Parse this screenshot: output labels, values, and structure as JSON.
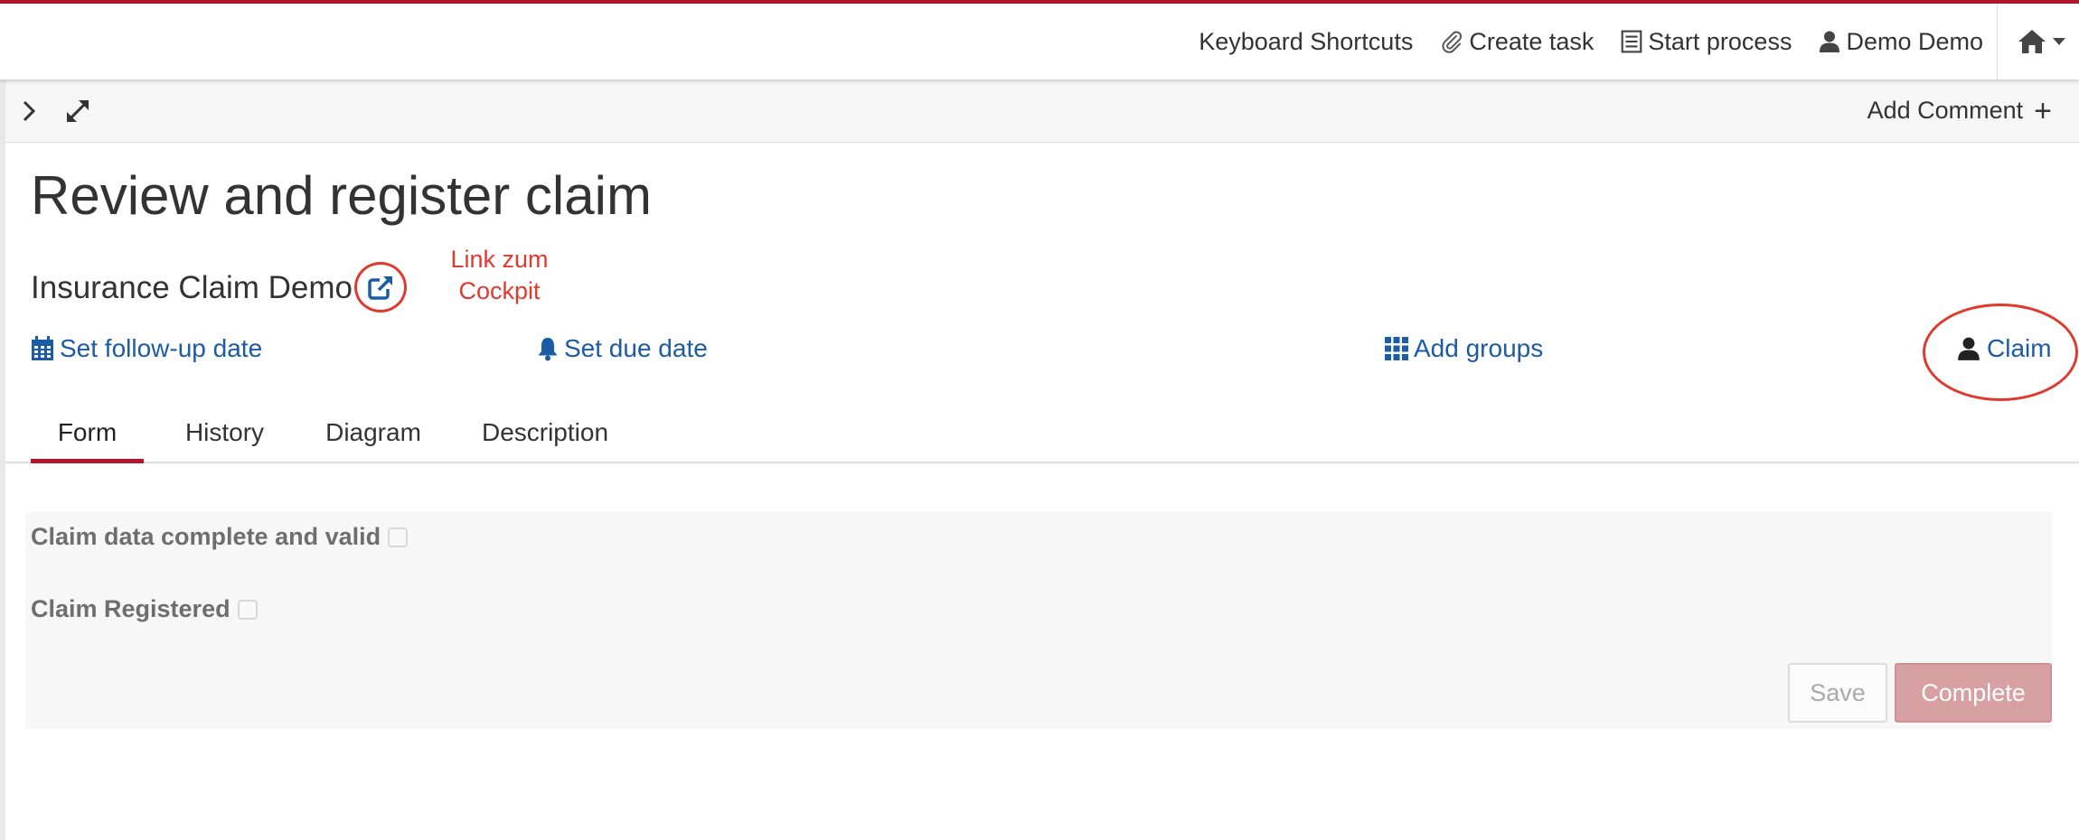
{
  "colors": {
    "brand": "#b5152b",
    "link": "#1c5ba5",
    "annotation": "#e03a2f",
    "complete_button": "#d7a0a3"
  },
  "navbar": {
    "keyboard_shortcuts": "Keyboard Shortcuts",
    "create_task": "Create task",
    "start_process": "Start process",
    "user": "Demo Demo",
    "icons": [
      "paperclip-icon",
      "list-icon",
      "user-icon",
      "home-icon",
      "caret-down-icon"
    ]
  },
  "toolbar": {
    "add_comment": "Add Comment",
    "add_comment_plus": "+",
    "icons": [
      "chevron-right-icon",
      "expand-icon"
    ]
  },
  "task": {
    "title": "Review and register claim",
    "process_name": "Insurance Claim Demo"
  },
  "annotation": {
    "line1": "Link zum",
    "line2": "Cockpit"
  },
  "actions": {
    "follow_up": "Set follow-up date",
    "due_date": "Set due date",
    "add_groups": "Add groups",
    "claim": "Claim"
  },
  "tabs": [
    {
      "label": "Form",
      "active": true
    },
    {
      "label": "History",
      "active": false
    },
    {
      "label": "Diagram",
      "active": false
    },
    {
      "label": "Description",
      "active": false
    }
  ],
  "form": {
    "fields": [
      {
        "label": "Claim data complete and valid",
        "checked": false
      },
      {
        "label": "Claim Registered",
        "checked": false
      }
    ],
    "save": "Save",
    "complete": "Complete"
  }
}
